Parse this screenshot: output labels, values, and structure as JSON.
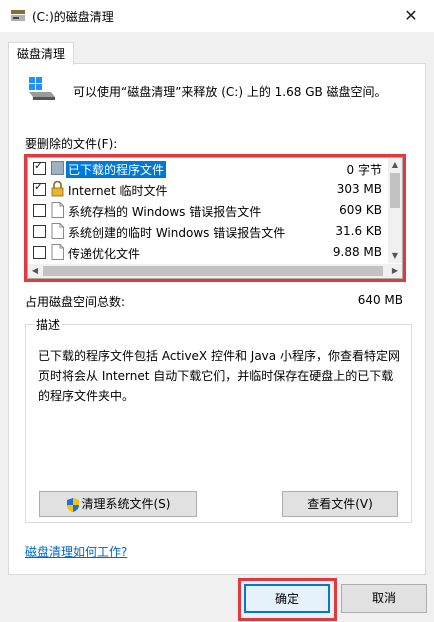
{
  "window": {
    "title": "(C:)的磁盘清理",
    "close_glyph": "✕"
  },
  "tab": {
    "label": "磁盘清理"
  },
  "header": {
    "text": "可以使用“磁盘清理”来释放 (C:) 上的 1.68 GB 磁盘空间。"
  },
  "files": {
    "label": "要删除的文件(F):",
    "items": [
      {
        "name": "已下载的程序文件",
        "size": "0 字节",
        "checked": true,
        "selected": true,
        "icon": "folder-icon"
      },
      {
        "name": "Internet 临时文件",
        "size": "303 MB",
        "checked": true,
        "selected": false,
        "icon": "lock-icon"
      },
      {
        "name": "系统存档的 Windows 错误报告文件",
        "size": "609 KB",
        "checked": false,
        "selected": false,
        "icon": "file-icon"
      },
      {
        "name": "系统创建的临时 Windows 错误报告文件",
        "size": "31.6 KB",
        "checked": false,
        "selected": false,
        "icon": "file-icon"
      },
      {
        "name": "传递优化文件",
        "size": "9.88 MB",
        "checked": false,
        "selected": false,
        "icon": "file-icon"
      }
    ]
  },
  "total": {
    "label": "占用磁盘空间总数:",
    "value": "640 MB"
  },
  "description": {
    "legend": "描述",
    "text": "已下载的程序文件包括 ActiveX 控件和 Java 小程序，你查看特定网页时将会从 Internet 自动下载它们，并临时保存在硬盘上的已下载的程序文件夹中。"
  },
  "buttons": {
    "cleanup_system": "清理系统文件(S)",
    "view_files": "查看文件(V)",
    "ok": "确定",
    "cancel": "取消"
  },
  "help_link": "磁盘清理如何工作?",
  "colors": {
    "accent": "#0078d7",
    "highlight_outline": "#e03a3e",
    "link": "#0066cc"
  }
}
